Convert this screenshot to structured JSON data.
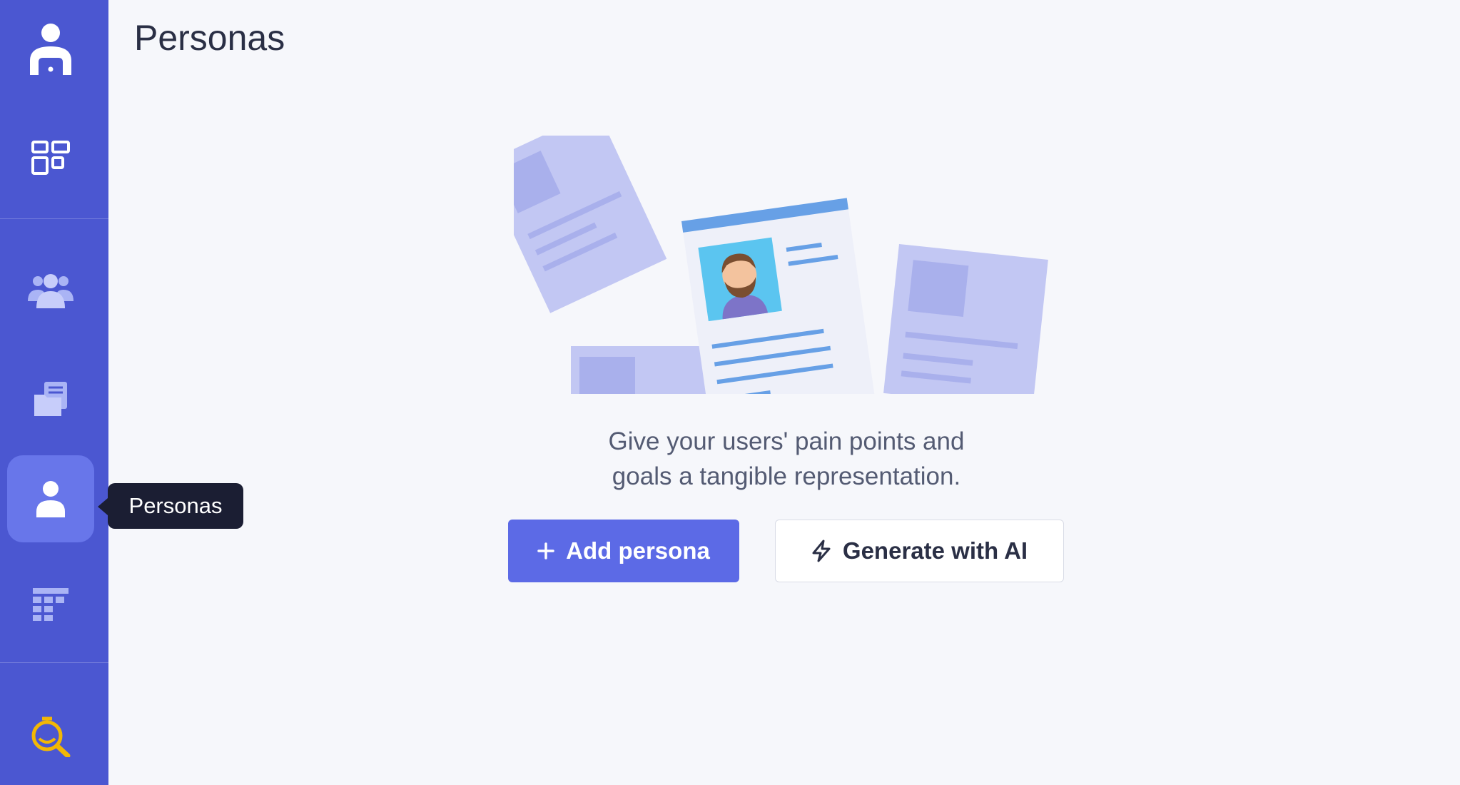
{
  "page": {
    "title": "Personas"
  },
  "sidebar": {
    "items": [
      {
        "name": "logo",
        "icon": "user-laptop-icon"
      },
      {
        "name": "dashboard",
        "icon": "grid-icon"
      },
      {
        "name": "teams",
        "icon": "users-group-icon"
      },
      {
        "name": "documents",
        "icon": "folder-documents-icon"
      },
      {
        "name": "personas",
        "icon": "person-icon",
        "active": true
      },
      {
        "name": "tables",
        "icon": "table-icon"
      },
      {
        "name": "research",
        "icon": "flask-search-icon"
      }
    ],
    "tooltip": "Personas"
  },
  "empty_state": {
    "description_line1": "Give your users' pain points and",
    "description_line2": "goals a tangible representation.",
    "add_button": "Add persona",
    "ai_button": "Generate with AI"
  },
  "colors": {
    "sidebar_bg": "#4b57d1",
    "active_item_bg": "#6876ea",
    "primary_button": "#5c6ae6",
    "research_icon": "#f2b705"
  }
}
